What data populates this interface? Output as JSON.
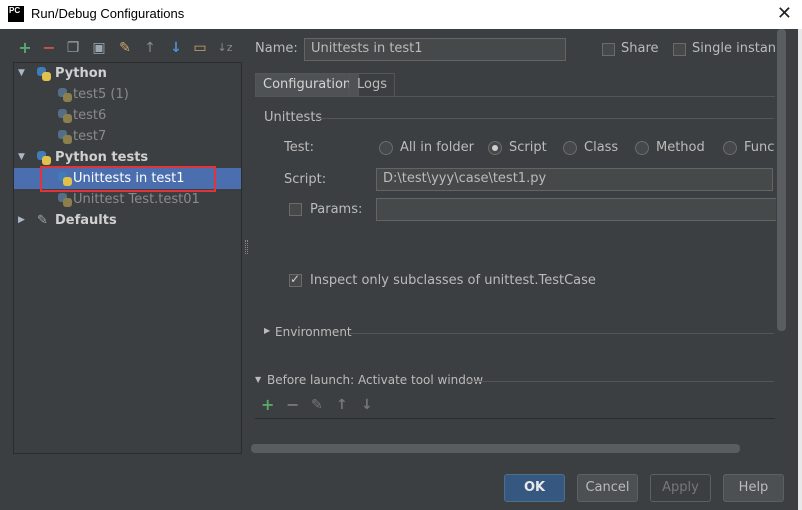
{
  "window": {
    "title": "Run/Debug Configurations",
    "app_icon": "PC"
  },
  "toolbar": [
    "add",
    "remove",
    "copy",
    "save",
    "edit-defaults",
    "move-up",
    "move-down",
    "folder",
    "sort"
  ],
  "tree": {
    "python_label": "Python",
    "python_children": [
      "test5 (1)",
      "test6",
      "test7"
    ],
    "python_tests_label": "Python tests",
    "python_tests_children": [
      "Unittests in test1",
      "Unittest Test.test01"
    ],
    "defaults_label": "Defaults"
  },
  "config": {
    "name_label": "Name:",
    "name_value": "Unittests in test1",
    "share_label": "Share",
    "single_instance_label": "Single instance"
  },
  "tabs": [
    "Configuration",
    "Logs"
  ],
  "unittests": {
    "section_label": "Unittests",
    "test_label": "Test:",
    "test_options": [
      "All in folder",
      "Script",
      "Class",
      "Method",
      "Function"
    ],
    "test_selected": "Script",
    "script_label": "Script:",
    "script_value": "D:\\test\\yyy\\case\\test1.py",
    "params_label": "Params:",
    "params_value": "",
    "inspect_label": "Inspect only subclasses of unittest.TestCase",
    "inspect_checked": true
  },
  "environment_label": "Environment",
  "before_launch_label": "Before launch: Activate tool window",
  "buttons": {
    "ok": "OK",
    "cancel": "Cancel",
    "apply": "Apply",
    "help": "Help"
  },
  "colors": {
    "selection": "#4b6eaf",
    "add_green": "#59a869",
    "remove_red": "#c75450",
    "highlight_box": "#e0343a"
  }
}
